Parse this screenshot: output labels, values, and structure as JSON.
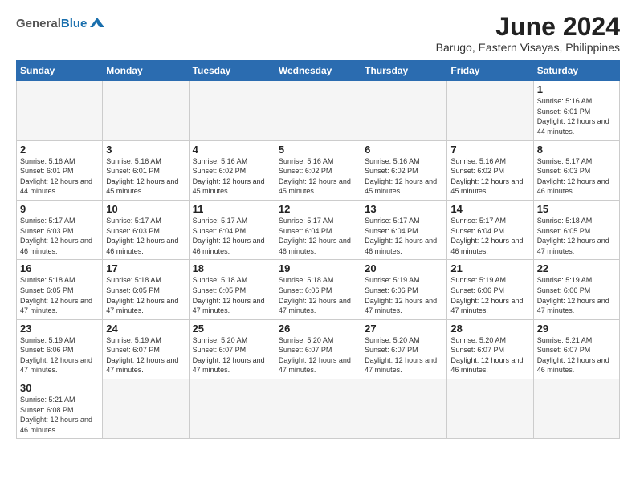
{
  "header": {
    "logo_general": "General",
    "logo_blue": "Blue",
    "month_year": "June 2024",
    "location": "Barugo, Eastern Visayas, Philippines"
  },
  "weekdays": [
    "Sunday",
    "Monday",
    "Tuesday",
    "Wednesday",
    "Thursday",
    "Friday",
    "Saturday"
  ],
  "weeks": [
    [
      {
        "day": "",
        "sunrise": "",
        "sunset": "",
        "daylight": "",
        "empty": true
      },
      {
        "day": "",
        "sunrise": "",
        "sunset": "",
        "daylight": "",
        "empty": true
      },
      {
        "day": "",
        "sunrise": "",
        "sunset": "",
        "daylight": "",
        "empty": true
      },
      {
        "day": "",
        "sunrise": "",
        "sunset": "",
        "daylight": "",
        "empty": true
      },
      {
        "day": "",
        "sunrise": "",
        "sunset": "",
        "daylight": "",
        "empty": true
      },
      {
        "day": "",
        "sunrise": "",
        "sunset": "",
        "daylight": "",
        "empty": true
      },
      {
        "day": "1",
        "sunrise": "Sunrise: 5:16 AM",
        "sunset": "Sunset: 6:01 PM",
        "daylight": "Daylight: 12 hours and 44 minutes.",
        "empty": false
      }
    ],
    [
      {
        "day": "2",
        "sunrise": "Sunrise: 5:16 AM",
        "sunset": "Sunset: 6:01 PM",
        "daylight": "Daylight: 12 hours and 44 minutes.",
        "empty": false
      },
      {
        "day": "3",
        "sunrise": "Sunrise: 5:16 AM",
        "sunset": "Sunset: 6:01 PM",
        "daylight": "Daylight: 12 hours and 45 minutes.",
        "empty": false
      },
      {
        "day": "4",
        "sunrise": "Sunrise: 5:16 AM",
        "sunset": "Sunset: 6:02 PM",
        "daylight": "Daylight: 12 hours and 45 minutes.",
        "empty": false
      },
      {
        "day": "5",
        "sunrise": "Sunrise: 5:16 AM",
        "sunset": "Sunset: 6:02 PM",
        "daylight": "Daylight: 12 hours and 45 minutes.",
        "empty": false
      },
      {
        "day": "6",
        "sunrise": "Sunrise: 5:16 AM",
        "sunset": "Sunset: 6:02 PM",
        "daylight": "Daylight: 12 hours and 45 minutes.",
        "empty": false
      },
      {
        "day": "7",
        "sunrise": "Sunrise: 5:16 AM",
        "sunset": "Sunset: 6:02 PM",
        "daylight": "Daylight: 12 hours and 45 minutes.",
        "empty": false
      },
      {
        "day": "8",
        "sunrise": "Sunrise: 5:17 AM",
        "sunset": "Sunset: 6:03 PM",
        "daylight": "Daylight: 12 hours and 46 minutes.",
        "empty": false
      }
    ],
    [
      {
        "day": "9",
        "sunrise": "Sunrise: 5:17 AM",
        "sunset": "Sunset: 6:03 PM",
        "daylight": "Daylight: 12 hours and 46 minutes.",
        "empty": false
      },
      {
        "day": "10",
        "sunrise": "Sunrise: 5:17 AM",
        "sunset": "Sunset: 6:03 PM",
        "daylight": "Daylight: 12 hours and 46 minutes.",
        "empty": false
      },
      {
        "day": "11",
        "sunrise": "Sunrise: 5:17 AM",
        "sunset": "Sunset: 6:04 PM",
        "daylight": "Daylight: 12 hours and 46 minutes.",
        "empty": false
      },
      {
        "day": "12",
        "sunrise": "Sunrise: 5:17 AM",
        "sunset": "Sunset: 6:04 PM",
        "daylight": "Daylight: 12 hours and 46 minutes.",
        "empty": false
      },
      {
        "day": "13",
        "sunrise": "Sunrise: 5:17 AM",
        "sunset": "Sunset: 6:04 PM",
        "daylight": "Daylight: 12 hours and 46 minutes.",
        "empty": false
      },
      {
        "day": "14",
        "sunrise": "Sunrise: 5:17 AM",
        "sunset": "Sunset: 6:04 PM",
        "daylight": "Daylight: 12 hours and 46 minutes.",
        "empty": false
      },
      {
        "day": "15",
        "sunrise": "Sunrise: 5:18 AM",
        "sunset": "Sunset: 6:05 PM",
        "daylight": "Daylight: 12 hours and 47 minutes.",
        "empty": false
      }
    ],
    [
      {
        "day": "16",
        "sunrise": "Sunrise: 5:18 AM",
        "sunset": "Sunset: 6:05 PM",
        "daylight": "Daylight: 12 hours and 47 minutes.",
        "empty": false
      },
      {
        "day": "17",
        "sunrise": "Sunrise: 5:18 AM",
        "sunset": "Sunset: 6:05 PM",
        "daylight": "Daylight: 12 hours and 47 minutes.",
        "empty": false
      },
      {
        "day": "18",
        "sunrise": "Sunrise: 5:18 AM",
        "sunset": "Sunset: 6:05 PM",
        "daylight": "Daylight: 12 hours and 47 minutes.",
        "empty": false
      },
      {
        "day": "19",
        "sunrise": "Sunrise: 5:18 AM",
        "sunset": "Sunset: 6:06 PM",
        "daylight": "Daylight: 12 hours and 47 minutes.",
        "empty": false
      },
      {
        "day": "20",
        "sunrise": "Sunrise: 5:19 AM",
        "sunset": "Sunset: 6:06 PM",
        "daylight": "Daylight: 12 hours and 47 minutes.",
        "empty": false
      },
      {
        "day": "21",
        "sunrise": "Sunrise: 5:19 AM",
        "sunset": "Sunset: 6:06 PM",
        "daylight": "Daylight: 12 hours and 47 minutes.",
        "empty": false
      },
      {
        "day": "22",
        "sunrise": "Sunrise: 5:19 AM",
        "sunset": "Sunset: 6:06 PM",
        "daylight": "Daylight: 12 hours and 47 minutes.",
        "empty": false
      }
    ],
    [
      {
        "day": "23",
        "sunrise": "Sunrise: 5:19 AM",
        "sunset": "Sunset: 6:06 PM",
        "daylight": "Daylight: 12 hours and 47 minutes.",
        "empty": false
      },
      {
        "day": "24",
        "sunrise": "Sunrise: 5:19 AM",
        "sunset": "Sunset: 6:07 PM",
        "daylight": "Daylight: 12 hours and 47 minutes.",
        "empty": false
      },
      {
        "day": "25",
        "sunrise": "Sunrise: 5:20 AM",
        "sunset": "Sunset: 6:07 PM",
        "daylight": "Daylight: 12 hours and 47 minutes.",
        "empty": false
      },
      {
        "day": "26",
        "sunrise": "Sunrise: 5:20 AM",
        "sunset": "Sunset: 6:07 PM",
        "daylight": "Daylight: 12 hours and 47 minutes.",
        "empty": false
      },
      {
        "day": "27",
        "sunrise": "Sunrise: 5:20 AM",
        "sunset": "Sunset: 6:07 PM",
        "daylight": "Daylight: 12 hours and 47 minutes.",
        "empty": false
      },
      {
        "day": "28",
        "sunrise": "Sunrise: 5:20 AM",
        "sunset": "Sunset: 6:07 PM",
        "daylight": "Daylight: 12 hours and 46 minutes.",
        "empty": false
      },
      {
        "day": "29",
        "sunrise": "Sunrise: 5:21 AM",
        "sunset": "Sunset: 6:07 PM",
        "daylight": "Daylight: 12 hours and 46 minutes.",
        "empty": false
      }
    ],
    [
      {
        "day": "30",
        "sunrise": "Sunrise: 5:21 AM",
        "sunset": "Sunset: 6:08 PM",
        "daylight": "Daylight: 12 hours and 46 minutes.",
        "empty": false
      },
      {
        "day": "",
        "sunrise": "",
        "sunset": "",
        "daylight": "",
        "empty": true
      },
      {
        "day": "",
        "sunrise": "",
        "sunset": "",
        "daylight": "",
        "empty": true
      },
      {
        "day": "",
        "sunrise": "",
        "sunset": "",
        "daylight": "",
        "empty": true
      },
      {
        "day": "",
        "sunrise": "",
        "sunset": "",
        "daylight": "",
        "empty": true
      },
      {
        "day": "",
        "sunrise": "",
        "sunset": "",
        "daylight": "",
        "empty": true
      },
      {
        "day": "",
        "sunrise": "",
        "sunset": "",
        "daylight": "",
        "empty": true
      }
    ]
  ]
}
